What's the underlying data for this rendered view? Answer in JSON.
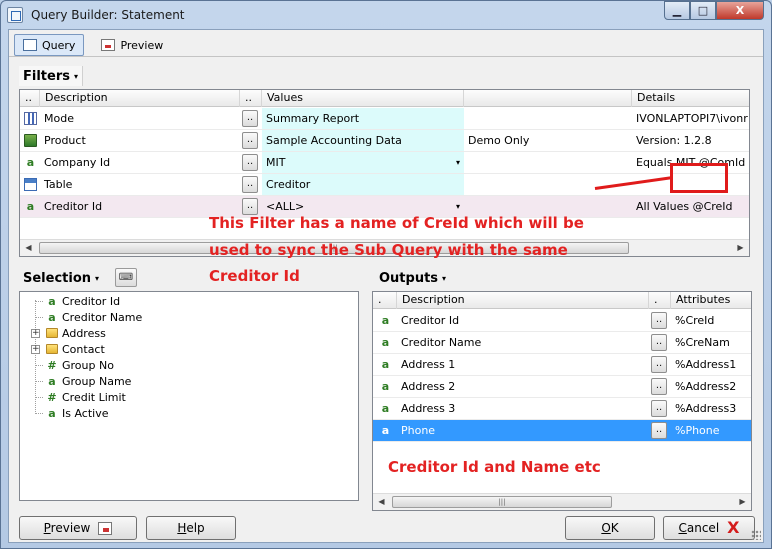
{
  "window": {
    "title": "Query Builder:  Statement",
    "min_glyph": "▁",
    "max_glyph": "□",
    "close_glyph": "X"
  },
  "tabs": [
    {
      "label": "Query",
      "active": true,
      "icon": "query-icon"
    },
    {
      "label": "Preview",
      "active": false,
      "icon": "preview-icon"
    }
  ],
  "filters": {
    "title": "Filters",
    "headers": {
      "c0": "..",
      "c1": "Description",
      "c2": "..",
      "c3": "Values",
      "c5": "Details"
    },
    "rows": [
      {
        "icon": "report-icon",
        "description": "Mode",
        "btn": "..",
        "value": "Summary Report",
        "extra": "",
        "details": "IVONLAPTOPI7\\ivonr",
        "dropdown": false
      },
      {
        "icon": "product-icon",
        "description": "Product",
        "btn": "..",
        "value": "Sample Accounting Data",
        "extra": "Demo Only",
        "details": "Version: 1.2.8",
        "dropdown": false
      },
      {
        "icon": "text-field-icon",
        "glyph": "a",
        "description": "Company Id",
        "btn": "..",
        "value": "MIT",
        "extra": "",
        "details": "Equals MIT @ComId",
        "dropdown": true
      },
      {
        "icon": "table-icon",
        "description": "Table",
        "btn": "..",
        "value": "Creditor",
        "extra": "",
        "details": "",
        "dropdown": false
      },
      {
        "icon": "text-field-icon",
        "glyph": "a",
        "description": "Creditor Id",
        "btn": "..",
        "value": "<ALL>",
        "extra": "",
        "details": "All Values @CreId",
        "dropdown": true
      }
    ],
    "scroll_left": "◀",
    "scroll_right": "▶",
    "scroll_grip": "|||"
  },
  "selection": {
    "title": "Selection",
    "items": [
      {
        "label": "Creditor Id",
        "glyph": "a",
        "type": "text"
      },
      {
        "label": "Creditor Name",
        "glyph": "a",
        "type": "text"
      },
      {
        "label": "Address",
        "glyph": "",
        "type": "folder",
        "expander": "+"
      },
      {
        "label": "Contact",
        "glyph": "",
        "type": "folder",
        "expander": "+"
      },
      {
        "label": "Group No",
        "glyph": "#",
        "type": "number"
      },
      {
        "label": "Group Name",
        "glyph": "a",
        "type": "text"
      },
      {
        "label": "Credit Limit",
        "glyph": "#",
        "type": "number"
      },
      {
        "label": "Is Active",
        "glyph": "a",
        "type": "text"
      }
    ]
  },
  "outputs": {
    "title": "Outputs",
    "headers": {
      "c0": ".",
      "c1": "Description",
      "c2": ".",
      "c3": "Attributes"
    },
    "rows": [
      {
        "glyph": "a",
        "description": "Creditor Id",
        "btn": "..",
        "attribute": "%CreId",
        "selected": false
      },
      {
        "glyph": "a",
        "description": "Creditor Name",
        "btn": "..",
        "attribute": "%CreNam",
        "selected": false
      },
      {
        "glyph": "a",
        "description": "Address 1",
        "btn": "..",
        "attribute": "%Address1",
        "selected": false
      },
      {
        "glyph": "a",
        "description": "Address 2",
        "btn": "..",
        "attribute": "%Address2",
        "selected": false
      },
      {
        "glyph": "a",
        "description": "Address 3",
        "btn": "..",
        "attribute": "%Address3",
        "selected": false
      },
      {
        "glyph": "a",
        "description": "Phone",
        "btn": "..",
        "attribute": "%Phone",
        "selected": true
      }
    ],
    "scroll_left": "◀",
    "scroll_right": "▶",
    "scroll_grip": "|||"
  },
  "annotations": {
    "line1": "This Filter has a name of CreId which will be",
    "line2": "used to sync the Sub Query with the same",
    "line3": "Creditor Id",
    "outputs_note": "Creditor Id and Name etc",
    "color": "#e32222"
  },
  "buttons": {
    "preview": {
      "mnemonic": "P",
      "rest": "review"
    },
    "help": {
      "mnemonic": "H",
      "rest": "elp"
    },
    "ok": {
      "mnemonic": "O",
      "rest": "K"
    },
    "cancel": {
      "mnemonic": "C",
      "rest": "ancel"
    }
  },
  "glyphs": {
    "caret": "▾",
    "small_btn": "⌨"
  }
}
